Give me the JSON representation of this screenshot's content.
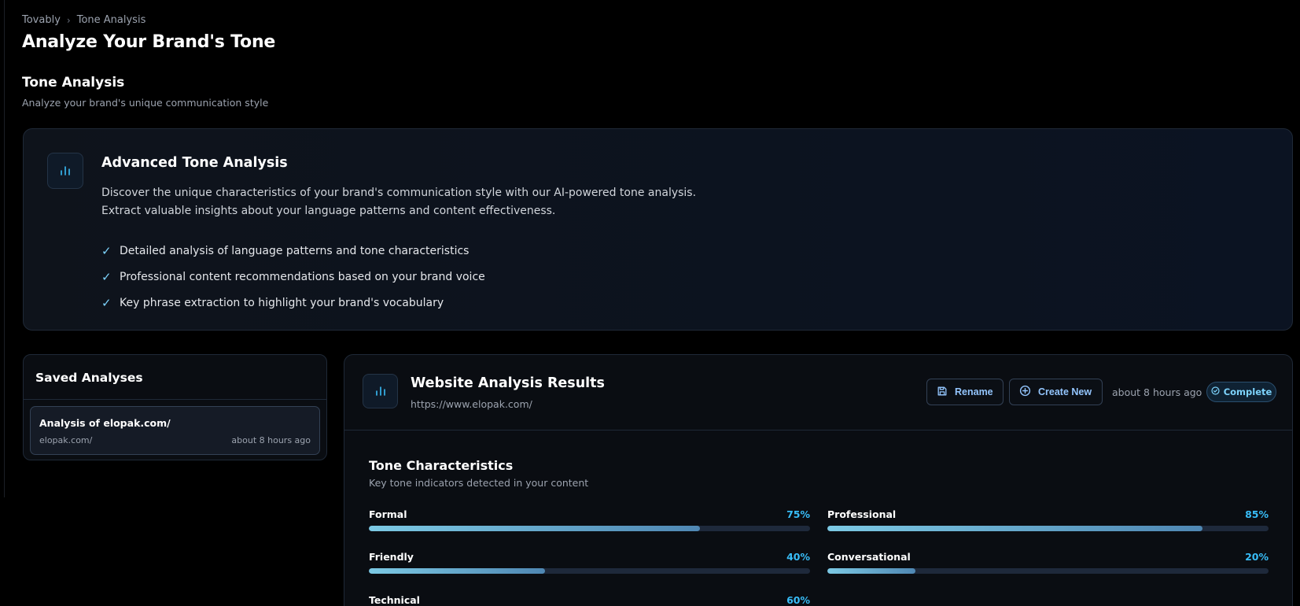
{
  "breadcrumb": {
    "root": "Tovably",
    "separator": "›",
    "current": "Tone Analysis"
  },
  "page": {
    "title": "Analyze Your Brand's Tone",
    "section_title": "Tone Analysis",
    "section_subtitle": "Analyze your brand's unique communication style"
  },
  "hero": {
    "icon": "bar-chart-icon",
    "title": "Advanced Tone Analysis",
    "description_line1": "Discover the unique characteristics of your brand's communication style with our AI-powered tone analysis.",
    "description_line2": "Extract valuable insights about your language patterns and content effectiveness.",
    "check_glyph": "✓",
    "features": [
      "Detailed analysis of language patterns and tone characteristics",
      "Professional content recommendations based on your brand voice",
      "Key phrase extraction to highlight your brand's vocabulary"
    ]
  },
  "saved": {
    "title": "Saved Analyses",
    "items": [
      {
        "title": "Analysis of elopak.com/",
        "domain": "elopak.com/",
        "time": "about 8 hours ago"
      }
    ]
  },
  "results": {
    "icon": "bar-chart-icon",
    "title": "Website Analysis Results",
    "url": "https://www.elopak.com/",
    "rename_label": "Rename",
    "create_label": "Create New",
    "time": "about 8 hours ago",
    "status": "Complete",
    "tone_title": "Tone Characteristics",
    "tone_subtitle": "Key tone indicators detected in your content",
    "tones": [
      {
        "label": "Formal",
        "value": 75,
        "display": "75%"
      },
      {
        "label": "Professional",
        "value": 85,
        "display": "85%"
      },
      {
        "label": "Friendly",
        "value": 40,
        "display": "40%"
      },
      {
        "label": "Conversational",
        "value": 20,
        "display": "20%"
      },
      {
        "label": "Technical",
        "value": 60,
        "display": "60%"
      }
    ]
  },
  "colors": {
    "background": "#000000",
    "accent": "#38bdf8",
    "bar_start": "#7cc9e4",
    "bar_end": "#4f87b3"
  }
}
